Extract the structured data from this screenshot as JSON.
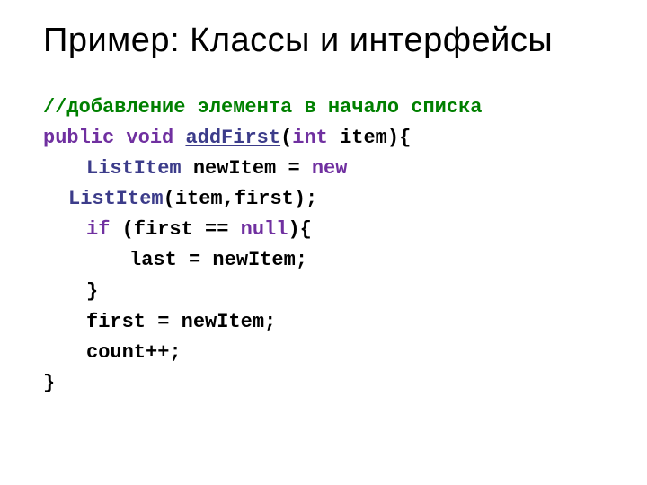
{
  "title": "Пример: Классы и интерфейсы",
  "code": {
    "l1_comment": "//добавление элемента в начало списка",
    "l2_public": "public",
    "l2_void": "void",
    "l2_addFirst": "addFirst",
    "l2_p1": "(",
    "l2_int": "int",
    "l2_item": " item){",
    "l3_ListItem": "ListItem",
    "l3_rest": " newItem = ",
    "l3_new": "new",
    "l3b_ListItem2": "ListItem",
    "l3b_rest": "(item,first);",
    "l4_if": "if",
    "l4_rest": " (first == ",
    "l4_null": "null",
    "l4_end": "){",
    "l5": "last = newItem;",
    "l6": "}",
    "l7": "first = newItem;",
    "l8": "count++;",
    "l9": "}"
  }
}
